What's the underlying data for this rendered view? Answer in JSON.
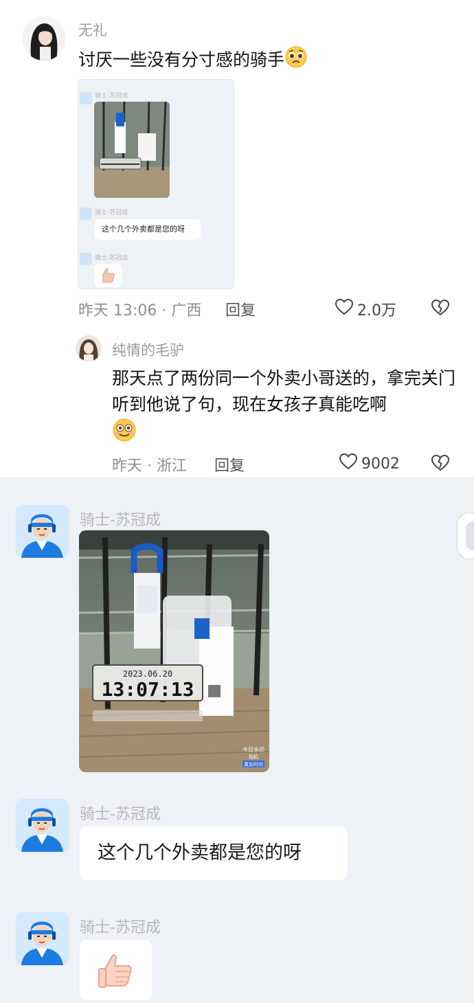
{
  "comment1": {
    "username": "无礼",
    "text": "讨厌一些没有分寸感的骑手",
    "time": "昨天 13:06 · 广西",
    "reply_label": "回复",
    "likes": "2.0万"
  },
  "comment1_thumb": {
    "sender": "骑士-苏冠成",
    "bubble": "这个几个外卖都是您的呀"
  },
  "comment2": {
    "username": "纯情的毛驴",
    "text": "那天点了两份同一个外卖小哥送的，拿完关门听到他说了句，现在女孩子真能吃啊",
    "time": "昨天 · 浙江",
    "reply_label": "回复",
    "likes": "9002"
  },
  "chat": {
    "sender1": "骑士-苏冠成",
    "sender2": "骑士-苏冠成",
    "sender3": "骑士-苏冠成",
    "photo_date": "2023.06.20",
    "photo_time": "13:07:13",
    "watermark_line1": "今日水印",
    "watermark_line2": "相机",
    "watermark_line3": "真实时间",
    "message": "这个几个外卖都是您的呀"
  },
  "colors": {
    "chat_bg": "#eef1f6",
    "rider_blue": "#1e7be0",
    "muted_text": "#9a9a9a"
  },
  "icons": [
    "heart-icon",
    "dislike-heart-icon",
    "thumbs-up-icon",
    "pleading-face-emoji",
    "smiling-face-emoji"
  ]
}
